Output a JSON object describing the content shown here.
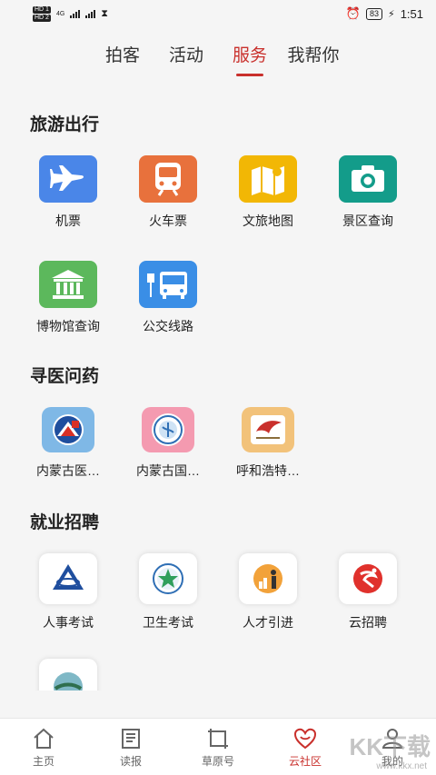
{
  "status": {
    "hd1": "HD 1",
    "hd2": "HD 2",
    "net": "4G",
    "battery": "83",
    "time": "1:51"
  },
  "nav": {
    "tabs": [
      {
        "label": "拍客"
      },
      {
        "label": "活动"
      },
      {
        "label": "服务"
      },
      {
        "label": "我帮你"
      }
    ],
    "active": 2
  },
  "sections": [
    {
      "title": "旅游出行",
      "items": [
        {
          "label": "机票",
          "icon": "airplane-icon"
        },
        {
          "label": "火车票",
          "icon": "train-icon"
        },
        {
          "label": "文旅地图",
          "icon": "map-icon"
        },
        {
          "label": "景区查询",
          "icon": "camera-icon"
        },
        {
          "label": "博物馆查询",
          "icon": "museum-icon"
        },
        {
          "label": "公交线路",
          "icon": "bus-icon"
        }
      ]
    },
    {
      "title": "寻医问药",
      "items": [
        {
          "label": "内蒙古医…",
          "icon": "hospital-logo-icon"
        },
        {
          "label": "内蒙古国…",
          "icon": "hospital-emblem-icon"
        },
        {
          "label": "呼和浩特…",
          "icon": "hospital-bird-icon"
        }
      ]
    },
    {
      "title": "就业招聘",
      "items": [
        {
          "label": "人事考试",
          "icon": "exam-logo-icon"
        },
        {
          "label": "卫生考试",
          "icon": "health-exam-icon"
        },
        {
          "label": "人才引进",
          "icon": "talent-icon"
        },
        {
          "label": "云招聘",
          "icon": "recruit-icon"
        }
      ]
    }
  ],
  "bottom": {
    "items": [
      {
        "label": "主页"
      },
      {
        "label": "读报"
      },
      {
        "label": "草原号"
      },
      {
        "label": "云社区"
      },
      {
        "label": "我的"
      }
    ],
    "active": 3
  },
  "watermark": {
    "text": "KK下载",
    "url": "www.kkx.net"
  }
}
